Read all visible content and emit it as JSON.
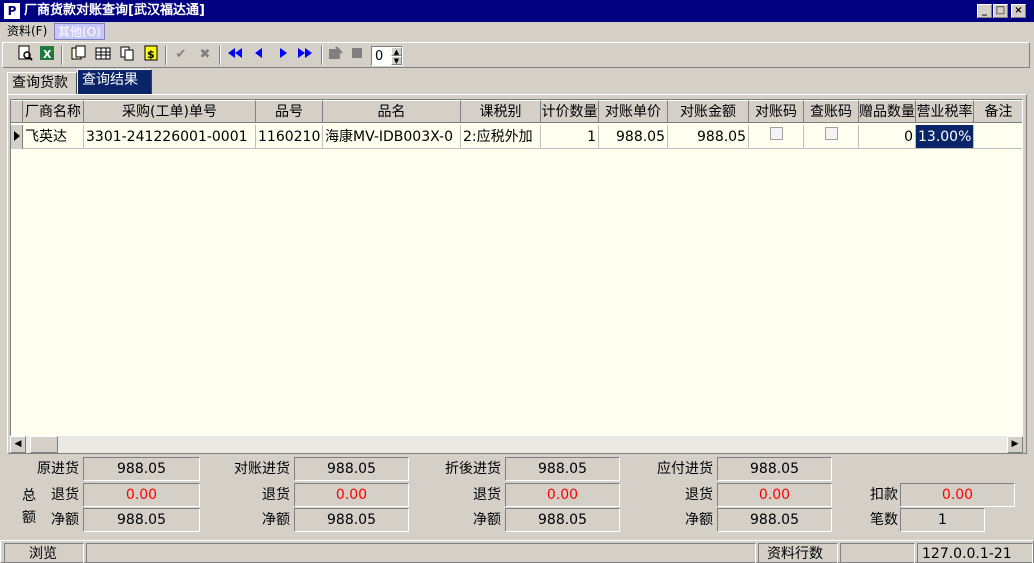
{
  "window": {
    "app_icon": "P",
    "title": "厂商货款对账查询[武汉福达通]",
    "controls": [
      "_",
      "□",
      "×"
    ]
  },
  "menu": {
    "items": [
      "资料(F)",
      "其他(O)"
    ]
  },
  "toolbar": {
    "icons": [
      "preview-icon",
      "excel-export-icon",
      "copy-icon",
      "grid-icon",
      "paste-icon",
      "dollar-icon",
      "check-icon",
      "cancel-icon",
      "first-record-icon",
      "prev-record-icon",
      "next-record-icon",
      "last-record-icon",
      "edit-icon",
      "stop-icon"
    ],
    "spin_value": "0"
  },
  "tabs": [
    "查询货款",
    "查询结果"
  ],
  "grid": {
    "columns": [
      "厂商名称",
      "采购(工单)单号",
      "品号",
      "品名",
      "课税别",
      "计价数量",
      "对账单价",
      "对账金额",
      "对账码",
      "查账码",
      "赠品数量",
      "营业税率",
      "备注"
    ],
    "rows": [
      {
        "vendor": "飞英达",
        "order_no": "3301-241226001-0001",
        "item_no": "1160210",
        "item_name": "海康MV-IDB003X-0",
        "tax_type": "2:应税外加",
        "qty": "1",
        "unit_price": "988.05",
        "amount": "988.05",
        "recon_code": false,
        "audit_code": false,
        "gift_qty": "0",
        "tax_rate": "13.00%",
        "remark": ""
      }
    ]
  },
  "summary": {
    "total_label_1": "总",
    "total_label_2": "额",
    "original": {
      "purchase_label": "原进货",
      "purchase": "988.05",
      "return_label": "退货",
      "return": "0.00",
      "net_label": "净额",
      "net": "988.05"
    },
    "recon": {
      "purchase_label": "对账进货",
      "purchase": "988.05",
      "return_label": "退货",
      "return": "0.00",
      "net_label": "净额",
      "net": "988.05"
    },
    "discounted": {
      "purchase_label": "折後进货",
      "purchase": "988.05",
      "return_label": "退货",
      "return": "0.00",
      "net_label": "净额",
      "net": "988.05"
    },
    "payable": {
      "purchase_label": "应付进货",
      "purchase": "988.05",
      "return_label": "退货",
      "return": "0.00",
      "net_label": "净额",
      "net": "988.05"
    },
    "deduction_label": "扣款",
    "deduction": "0.00",
    "count_label": "笔数",
    "count": "1"
  },
  "status": {
    "mode": "浏览",
    "row_count_label": "资料行数",
    "row_count": "",
    "host": "127.0.0.1-21"
  },
  "colors": {
    "title_bar": "#000080",
    "selection": "#0a246a",
    "grid_bg": "#fffff0",
    "negative": "#ff0000"
  }
}
